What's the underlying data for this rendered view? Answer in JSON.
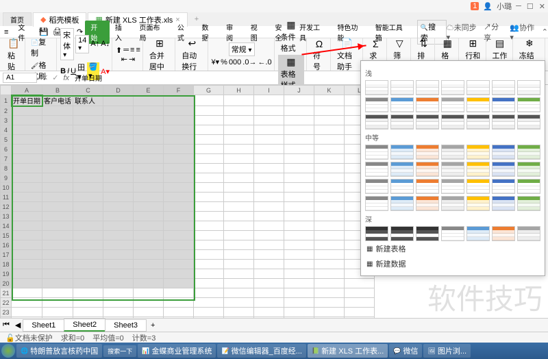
{
  "titlebar": {
    "user": "小璐",
    "badge": "1"
  },
  "topTabs": {
    "home": "首页",
    "template": "稻壳模板",
    "doc": "新建 XLS 工作表.xls"
  },
  "ribbonTabs": [
    "文件",
    "开始",
    "插入",
    "页面布局",
    "公式",
    "数据",
    "审阅",
    "视图",
    "安全",
    "开发工具",
    "特色功能",
    "智能工具箱"
  ],
  "search": "搜索",
  "rightTools": {
    "sync": "未同步",
    "share": "分享",
    "coop": "协作"
  },
  "ribbon": {
    "paste": "粘贴",
    "copy": "复制",
    "format": "格式刷",
    "font": "宋体",
    "size": "14",
    "merge": "合并居中",
    "wrap": "自动换行",
    "numfmt": "常规",
    "condfmt": "条件格式",
    "tablestyle": "表格样式",
    "symbol": "符号",
    "doc": "文档助手",
    "sum": "求和",
    "filter": "筛选",
    "sort": "排序",
    "format2": "格式",
    "rowcol": "行和列",
    "sheet": "工作表",
    "freeze": "冻结窗格"
  },
  "formula": {
    "cell": "A1",
    "value": "开单日期"
  },
  "cols": [
    "A",
    "B",
    "C",
    "D",
    "E",
    "F",
    "G",
    "H",
    "I",
    "J",
    "K",
    "L"
  ],
  "headers": {
    "a": "开单日期",
    "b": "客户电话",
    "c": "联系人"
  },
  "sheets": [
    "Sheet1",
    "Sheet2",
    "Sheet3"
  ],
  "status": {
    "protect": "文档未保护",
    "sum": "求和=0",
    "avg": "平均值=0",
    "count": "计数=3"
  },
  "styles": {
    "light": "浅",
    "medium": "中等",
    "dark": "深",
    "newTable": "新建表格",
    "newData": "新建数据"
  },
  "taskbar": [
    "特朗普放言核药中国",
    "搜索一下",
    "金蝶商业管理系统",
    "微信编辑器_百度经...",
    "新建 XLS 工作表...",
    "微信",
    "图片浏..."
  ],
  "watermark": "软件技巧"
}
